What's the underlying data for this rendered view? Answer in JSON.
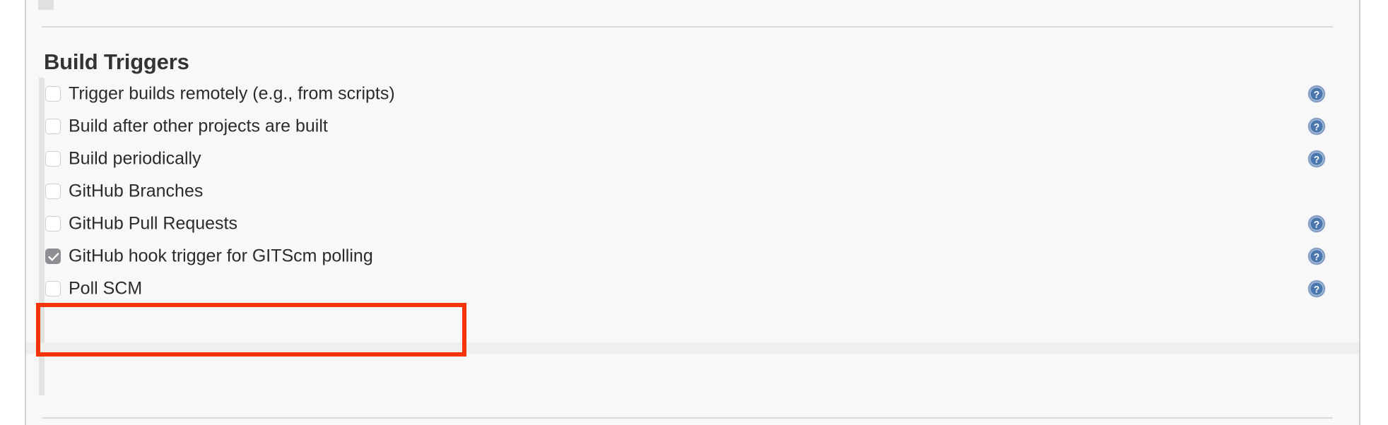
{
  "section": {
    "title": "Build Triggers"
  },
  "triggers": [
    {
      "label": "Trigger builds remotely (e.g., from scripts)",
      "checked": false,
      "has_help": true,
      "help_icon": "help-question-icon"
    },
    {
      "label": "Build after other projects are built",
      "checked": false,
      "has_help": true,
      "help_icon": "help-question-icon"
    },
    {
      "label": "Build periodically",
      "checked": false,
      "has_help": true,
      "help_icon": "help-question-icon"
    },
    {
      "label": "GitHub Branches",
      "checked": false,
      "has_help": false,
      "help_icon": ""
    },
    {
      "label": "GitHub Pull Requests",
      "checked": false,
      "has_help": true,
      "help_icon": "help-question-icon"
    },
    {
      "label": "GitHub hook trigger for GITScm polling",
      "checked": true,
      "has_help": true,
      "help_icon": "help-question-icon"
    },
    {
      "label": "Poll SCM",
      "checked": false,
      "has_help": true,
      "help_icon": "help-question-icon"
    }
  ],
  "annotation": {
    "kind": "highlight-rectangle",
    "target_label": "GitHub hook trigger for GITScm polling",
    "color": "#f73407"
  },
  "colors": {
    "page_background": "#f8f8f8",
    "outer_background": "#ffffff",
    "heading_text": "#333333",
    "label_text": "#2b2b2b",
    "checkbox_border": "#cfcfcf",
    "checkbox_checked_fill": "#8e8e93",
    "help_icon_blue": "#4a77ad",
    "divider": "#dcdcdc",
    "indent_bar": "#e2e2e2",
    "grey_band": "#efefef",
    "annotation_red": "#f73407"
  }
}
